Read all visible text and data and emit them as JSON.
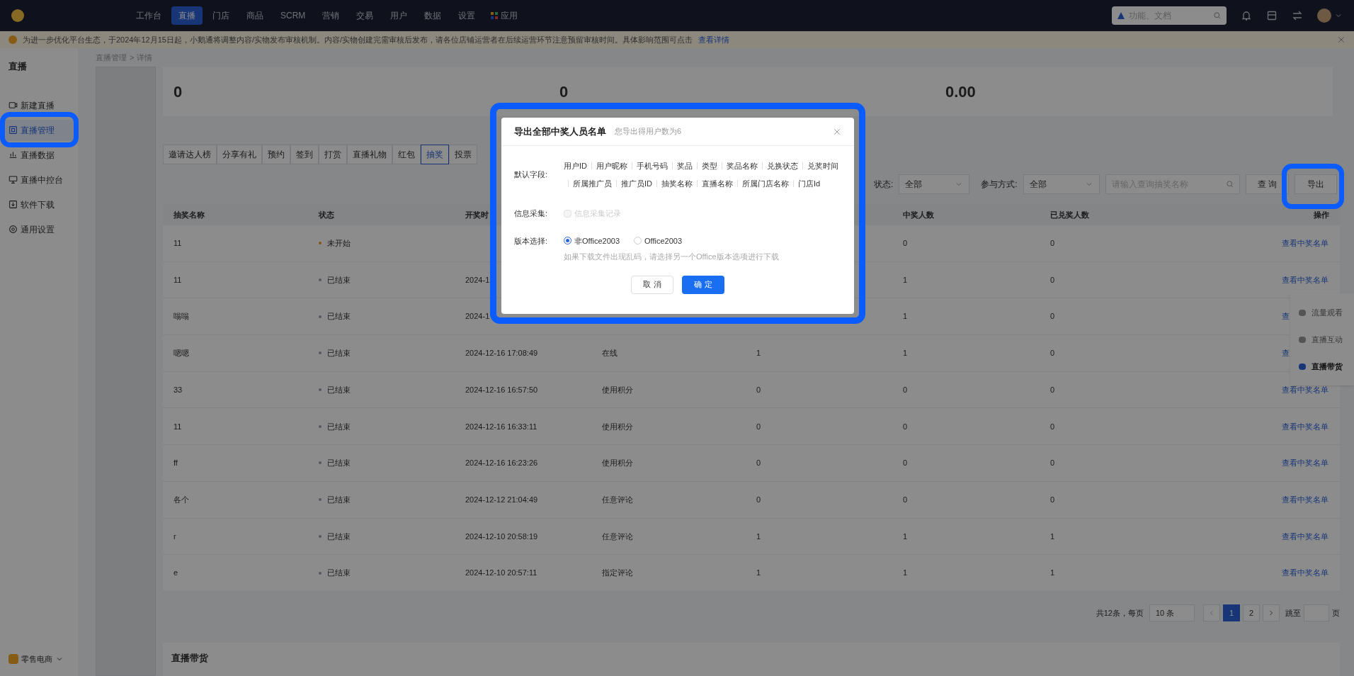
{
  "top_nav": {
    "items": [
      {
        "label": "工作台",
        "selected": false
      },
      {
        "label": "直播",
        "selected": true
      },
      {
        "label": "门店",
        "selected": false
      },
      {
        "label": "商品",
        "selected": false
      },
      {
        "label": "SCRM",
        "selected": false
      },
      {
        "label": "营销",
        "selected": false
      },
      {
        "label": "交易",
        "selected": false
      },
      {
        "label": "用户",
        "selected": false
      },
      {
        "label": "数据",
        "selected": false
      },
      {
        "label": "设置",
        "selected": false
      }
    ],
    "apps_label": "应用",
    "search": {
      "placeholder": "功能、文档"
    }
  },
  "notice": {
    "text": "为进一步优化平台生态，于2024年12月15日起，小鹅通将调整内容/实物发布审核机制。内容/实物创建完需审核后发布，请各位店铺运营者在后续运营环节注意预留审核时间。具体影响范围可点击",
    "link": "查看详情"
  },
  "sidebar": {
    "title": "直播",
    "items": [
      {
        "label": "新建直播",
        "selected": false
      },
      {
        "label": "直播管理",
        "selected": true
      },
      {
        "label": "直播数据",
        "selected": false
      },
      {
        "label": "直播中控台",
        "selected": false
      },
      {
        "label": "软件下载",
        "selected": false
      },
      {
        "label": "通用设置",
        "selected": false
      }
    ],
    "footer": "零售电商"
  },
  "breadcrumb": [
    "直播管理",
    "详情"
  ],
  "breadcrumb_separator": ">",
  "stats": [
    "0",
    "0",
    "0.00"
  ],
  "tabs": [
    {
      "label": "邀请达人榜",
      "selected": false
    },
    {
      "label": "分享有礼",
      "selected": false
    },
    {
      "label": "预约",
      "selected": false
    },
    {
      "label": "签到",
      "selected": false
    },
    {
      "label": "打赏",
      "selected": false
    },
    {
      "label": "直播礼物",
      "selected": false
    },
    {
      "label": "红包",
      "selected": false
    },
    {
      "label": "抽奖",
      "selected": true
    },
    {
      "label": "投票",
      "selected": false
    }
  ],
  "filters": {
    "status_label": "状态:",
    "status_value": "全部",
    "mode_label": "参与方式:",
    "mode_value": "全部",
    "search_placeholder": "请输入查询抽奖名称",
    "query_button": "查 询",
    "export_button": "导出"
  },
  "table": {
    "columns": [
      "抽奖名称",
      "状态",
      "开奖时",
      "",
      "",
      "中奖人数",
      "已兑奖人数",
      "操作"
    ],
    "rows": [
      {
        "name": "11",
        "status": "未开始",
        "color": "#875513",
        "time": "",
        "mode": "",
        "column_5": "",
        "winners": "0",
        "redeemed": "0",
        "action": "查看中奖名单"
      },
      {
        "name": "11",
        "status": "已结束",
        "color": "#565a60",
        "time": "2024-1",
        "mode": "",
        "column_5": "",
        "winners": "1",
        "redeemed": "0",
        "action": "查看中奖名单"
      },
      {
        "name": "嗡嗡",
        "status": "已结束",
        "color": "#565a60",
        "time": "2024-1",
        "mode": "",
        "column_5": "",
        "winners": "1",
        "redeemed": "0",
        "action": "查"
      },
      {
        "name": "嗯嗯",
        "status": "已结束",
        "color": "#565a60",
        "time": "2024-12-16 17:08:49",
        "mode": "在线",
        "column_5": "1",
        "winners": "1",
        "redeemed": "0",
        "action": "查"
      },
      {
        "name": "33",
        "status": "已结束",
        "color": "#565a60",
        "time": "2024-12-16 16:57:50",
        "mode": "使用积分",
        "column_5": "0",
        "winners": "0",
        "redeemed": "0",
        "action": "查看中奖名单"
      },
      {
        "name": "11",
        "status": "已结束",
        "color": "#565a60",
        "time": "2024-12-16 16:33:11",
        "mode": "使用积分",
        "column_5": "0",
        "winners": "0",
        "redeemed": "0",
        "action": "查看中奖名单"
      },
      {
        "name": "ff",
        "status": "已结束",
        "color": "#565a60",
        "time": "2024-12-16 16:23:26",
        "mode": "使用积分",
        "column_5": "0",
        "winners": "0",
        "redeemed": "0",
        "action": "查看中奖名单"
      },
      {
        "name": "各个",
        "status": "已结束",
        "color": "#565a60",
        "time": "2024-12-12 21:04:49",
        "mode": "任意评论",
        "column_5": "0",
        "winners": "0",
        "redeemed": "0",
        "action": "查看中奖名单"
      },
      {
        "name": "r",
        "status": "已结束",
        "color": "#565a60",
        "time": "2024-12-10 20:58:19",
        "mode": "任意评论",
        "column_5": "1",
        "winners": "1",
        "redeemed": "1",
        "action": "查看中奖名单"
      },
      {
        "name": "e",
        "status": "已结束",
        "color": "#565a60",
        "time": "2024-12-10 20:57:11",
        "mode": "指定评论",
        "column_5": "1",
        "winners": "1",
        "redeemed": "1",
        "action": "查看中奖名单"
      }
    ]
  },
  "pagination": {
    "total": "共12条，每页",
    "page_size": "10 条",
    "pages": [
      {
        "label": "1",
        "selected": true
      },
      {
        "label": "2",
        "selected": false
      }
    ],
    "jump_label": "跳至",
    "page_suffix": "页"
  },
  "section_title": "直播带货",
  "float_panel": [
    {
      "label": "流量观看",
      "selected": false
    },
    {
      "label": "直播互动",
      "selected": false
    },
    {
      "label": "直播带货",
      "selected": true
    }
  ],
  "dialog": {
    "title": "导出全部中奖人员名单",
    "subtitle": "您导出得用户数为6",
    "fields_label": "默认字段:",
    "fields": [
      "用户ID",
      "用户昵称",
      "手机号码",
      "奖品",
      "类型",
      "奖品名称",
      "兑换状态",
      "兑奖时间",
      "所属推广员",
      "推广员ID",
      "抽奖名称",
      "直播名称",
      "所属门店名称",
      "门店Id"
    ],
    "collect_label": "信息采集:",
    "collect": {
      "label": "信息采集记录",
      "checked": false,
      "disabled": true
    },
    "version_label": "版本选择:",
    "versions": [
      {
        "label": "非Office2003",
        "selected": true
      },
      {
        "label": "Office2003",
        "selected": false
      }
    ],
    "hint": "如果下载文件出现乱码，请选择另一个Office版本选项进行下载",
    "cancel": "取 消",
    "confirm": "确 定"
  }
}
